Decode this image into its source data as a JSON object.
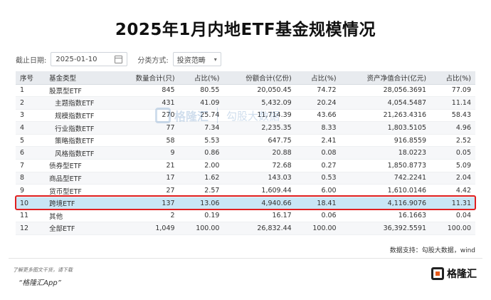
{
  "title": "2025年1月内地ETF基金规模情况",
  "filters": {
    "date_label": "截止日期:",
    "date_value": "2025-01-10",
    "category_label": "分类方式:",
    "category_value": "投资范畴"
  },
  "table": {
    "headers": [
      "序号",
      "基金类型",
      "数量合计(只)",
      "占比(%)",
      "份额合计(亿份)",
      "占比(%)",
      "资产净值合计(亿元)",
      "占比(%)"
    ],
    "rows": [
      [
        "1",
        "股票型ETF",
        "845",
        "80.55",
        "20,050.45",
        "74.72",
        "28,056.3691",
        "77.09"
      ],
      [
        "2",
        "主题指数ETF",
        "431",
        "41.09",
        "5,432.09",
        "20.24",
        "4,054.5487",
        "11.14"
      ],
      [
        "3",
        "规模指数ETF",
        "270",
        "25.74",
        "11,714.39",
        "43.66",
        "21,263.4316",
        "58.43"
      ],
      [
        "4",
        "行业指数ETF",
        "77",
        "7.34",
        "2,235.35",
        "8.33",
        "1,803.5105",
        "4.96"
      ],
      [
        "5",
        "策略指数ETF",
        "58",
        "5.53",
        "647.75",
        "2.41",
        "916.8559",
        "2.52"
      ],
      [
        "6",
        "风格指数ETF",
        "9",
        "0.86",
        "20.88",
        "0.08",
        "18.0223",
        "0.05"
      ],
      [
        "7",
        "债券型ETF",
        "21",
        "2.00",
        "72.68",
        "0.27",
        "1,850.8773",
        "5.09"
      ],
      [
        "8",
        "商品型ETF",
        "17",
        "1.62",
        "143.03",
        "0.53",
        "742.2241",
        "2.04"
      ],
      [
        "9",
        "货币型ETF",
        "27",
        "2.57",
        "1,609.44",
        "6.00",
        "1,610.0146",
        "4.42"
      ],
      [
        "10",
        "跨境ETF",
        "137",
        "13.06",
        "4,940.66",
        "18.41",
        "4,116.9076",
        "11.31"
      ],
      [
        "11",
        "其他",
        "2",
        "0.19",
        "16.17",
        "0.06",
        "16.1663",
        "0.04"
      ],
      [
        "12",
        "全部ETF",
        "1,049",
        "100.00",
        "26,832.44",
        "100.00",
        "36,392.5591",
        "100.00"
      ]
    ],
    "indented_rows": [
      1,
      2,
      3,
      4,
      5
    ],
    "highlighted_row": 9
  },
  "watermark": {
    "brand": "格隆汇",
    "text": "勾股大数据",
    "url": "www.gogudata.com"
  },
  "source": "数据支持：勾股大数据，wind",
  "footer": {
    "note": "了解更多图文干货，请下载",
    "app": "“格隆汇App”",
    "brand": "格隆汇"
  },
  "colors": {
    "highlight_fill": "#c9e6f5",
    "highlight_border": "#e02020",
    "header_bg": "#e8ebef"
  }
}
